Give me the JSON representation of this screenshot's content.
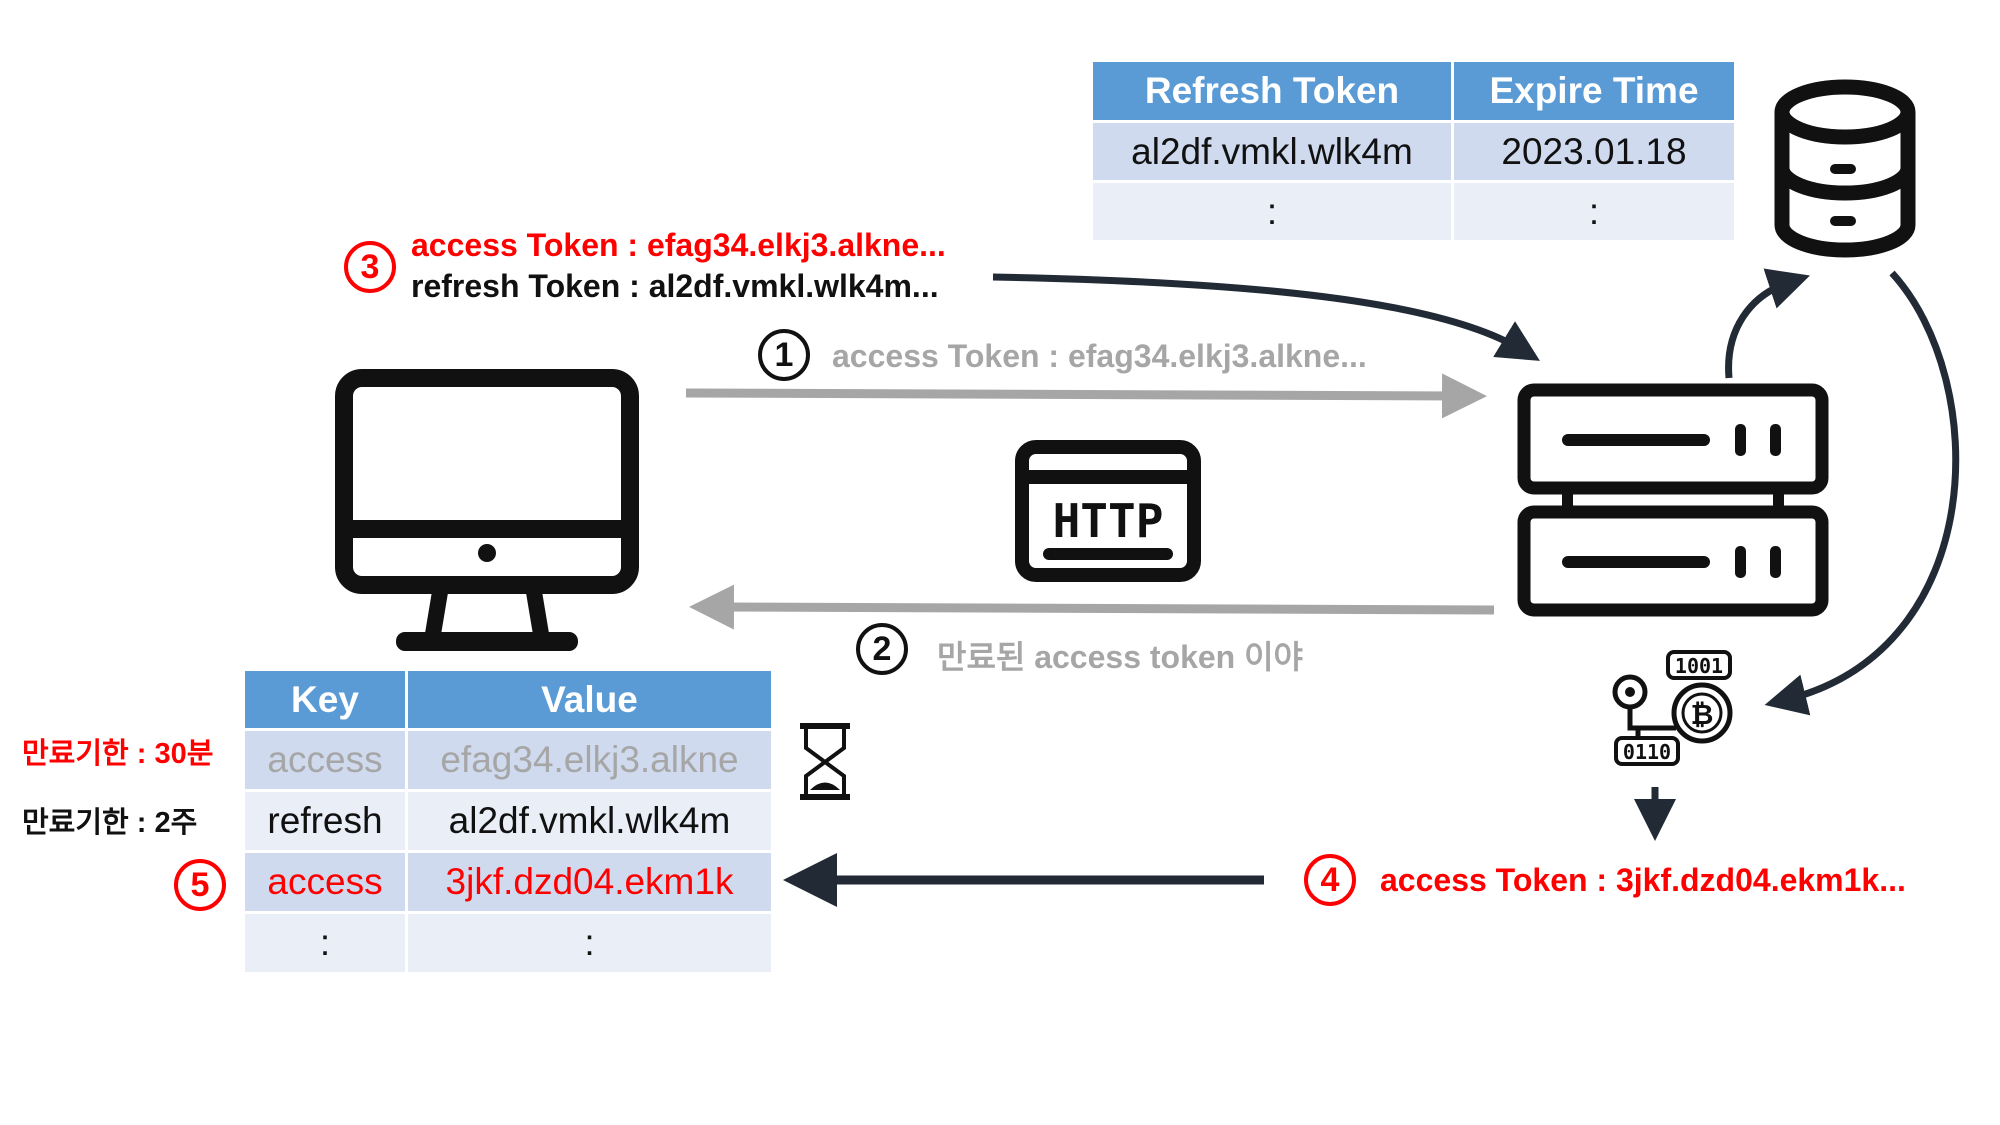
{
  "colors": {
    "header_blue": "#5B9BD5",
    "row_dark": "#CFDAEE",
    "row_light": "#E9EEF7",
    "red": "#FF0000",
    "gray": "#A6A6A6",
    "dark": "#222A35"
  },
  "icons": [
    "monitor-icon",
    "http-icon",
    "server-icon",
    "database-icon",
    "hourglass-icon",
    "crypto-key-icon"
  ],
  "server_table": {
    "headers": [
      "Refresh Token",
      "Expire Time"
    ],
    "rows": [
      [
        "al2df.vmkl.wlk4m",
        "2023.01.18"
      ],
      [
        ":",
        ":"
      ]
    ]
  },
  "client_table": {
    "headers": [
      "Key",
      "Value"
    ],
    "rows": [
      [
        "access",
        "efag34.elkj3.alkne"
      ],
      [
        "refresh",
        "al2df.vmkl.wlk4m"
      ],
      [
        "access",
        "3jkf.dzd04.ekm1k"
      ],
      [
        ":",
        ":"
      ]
    ]
  },
  "labels": {
    "expire_access": "만료기한 : 30분",
    "expire_refresh": "만료기한 : 2주",
    "http_text": "HTTP",
    "crypto_top": "1001",
    "crypto_bottom": "0110"
  },
  "steps": [
    {
      "num": "1",
      "lines": [
        "access Token : efag34.elkj3.alkne..."
      ]
    },
    {
      "num": "2",
      "lines": [
        "만료된 access token 이야"
      ]
    },
    {
      "num": "3",
      "lines": [
        "access Token : efag34.elkj3.alkne...",
        "refresh Token : al2df.vmkl.wlk4m..."
      ]
    },
    {
      "num": "4",
      "lines": [
        "access Token : 3jkf.dzd04.ekm1k..."
      ]
    },
    {
      "num": "5",
      "lines": []
    }
  ]
}
